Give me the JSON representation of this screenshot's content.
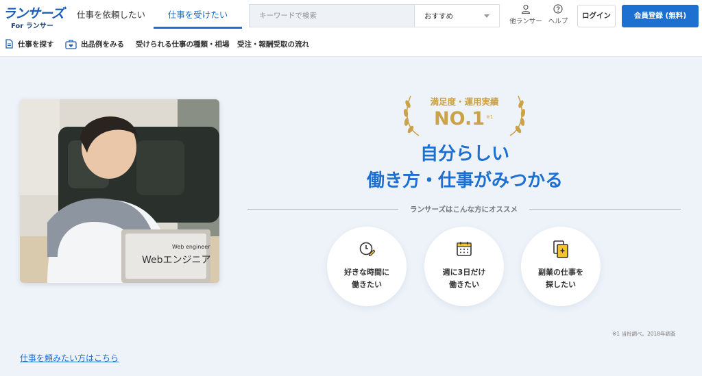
{
  "header": {
    "logo_main": "ランサーズ",
    "logo_sub": "For ランサー",
    "tabs": [
      {
        "label": "仕事を依頼したい"
      },
      {
        "label": "仕事を受けたい"
      }
    ],
    "search": {
      "placeholder": "キーワードで検索",
      "value": ""
    },
    "sort": {
      "selected": "おすすめ"
    },
    "other_lancer": "他ランサー",
    "help": "ヘルプ",
    "login": "ログイン",
    "register": "会員登録 (無料)"
  },
  "subnav": {
    "items": [
      {
        "label": "仕事を探す",
        "icon": "document-icon"
      },
      {
        "label": "出品例をみる",
        "icon": "briefcase-heart-icon"
      },
      {
        "label": "受けられる仕事の種類・相場"
      },
      {
        "label": "受注・報酬受取の流れ"
      }
    ]
  },
  "hero": {
    "photo_caption_sub": "Web engineer",
    "photo_caption": "Webエンジニア",
    "award_label": "満足度・運用実績",
    "award_no": "NO.1",
    "award_note": "※1",
    "headline_line1": "自分らしい",
    "headline_line2": "働き方・仕事がみつかる",
    "recommend": "ランサーズはこんな方にオススメ",
    "features": [
      {
        "line1": "好きな時間に",
        "line2": "働きたい",
        "icon": "clock-pencil-icon"
      },
      {
        "line1": "週に3日だけ",
        "line2": "働きたい",
        "icon": "calendar-icon"
      },
      {
        "line1": "副業の仕事を",
        "line2": "探したい",
        "icon": "documents-sparkle-icon"
      }
    ],
    "footnote": "※1 当社調べ。2018年調査",
    "order_link": "仕事を頼みたい方はこちら"
  },
  "colors": {
    "brand_blue": "#1d6fd0",
    "gold": "#c9a24a",
    "page_background": "#eef3f9"
  }
}
